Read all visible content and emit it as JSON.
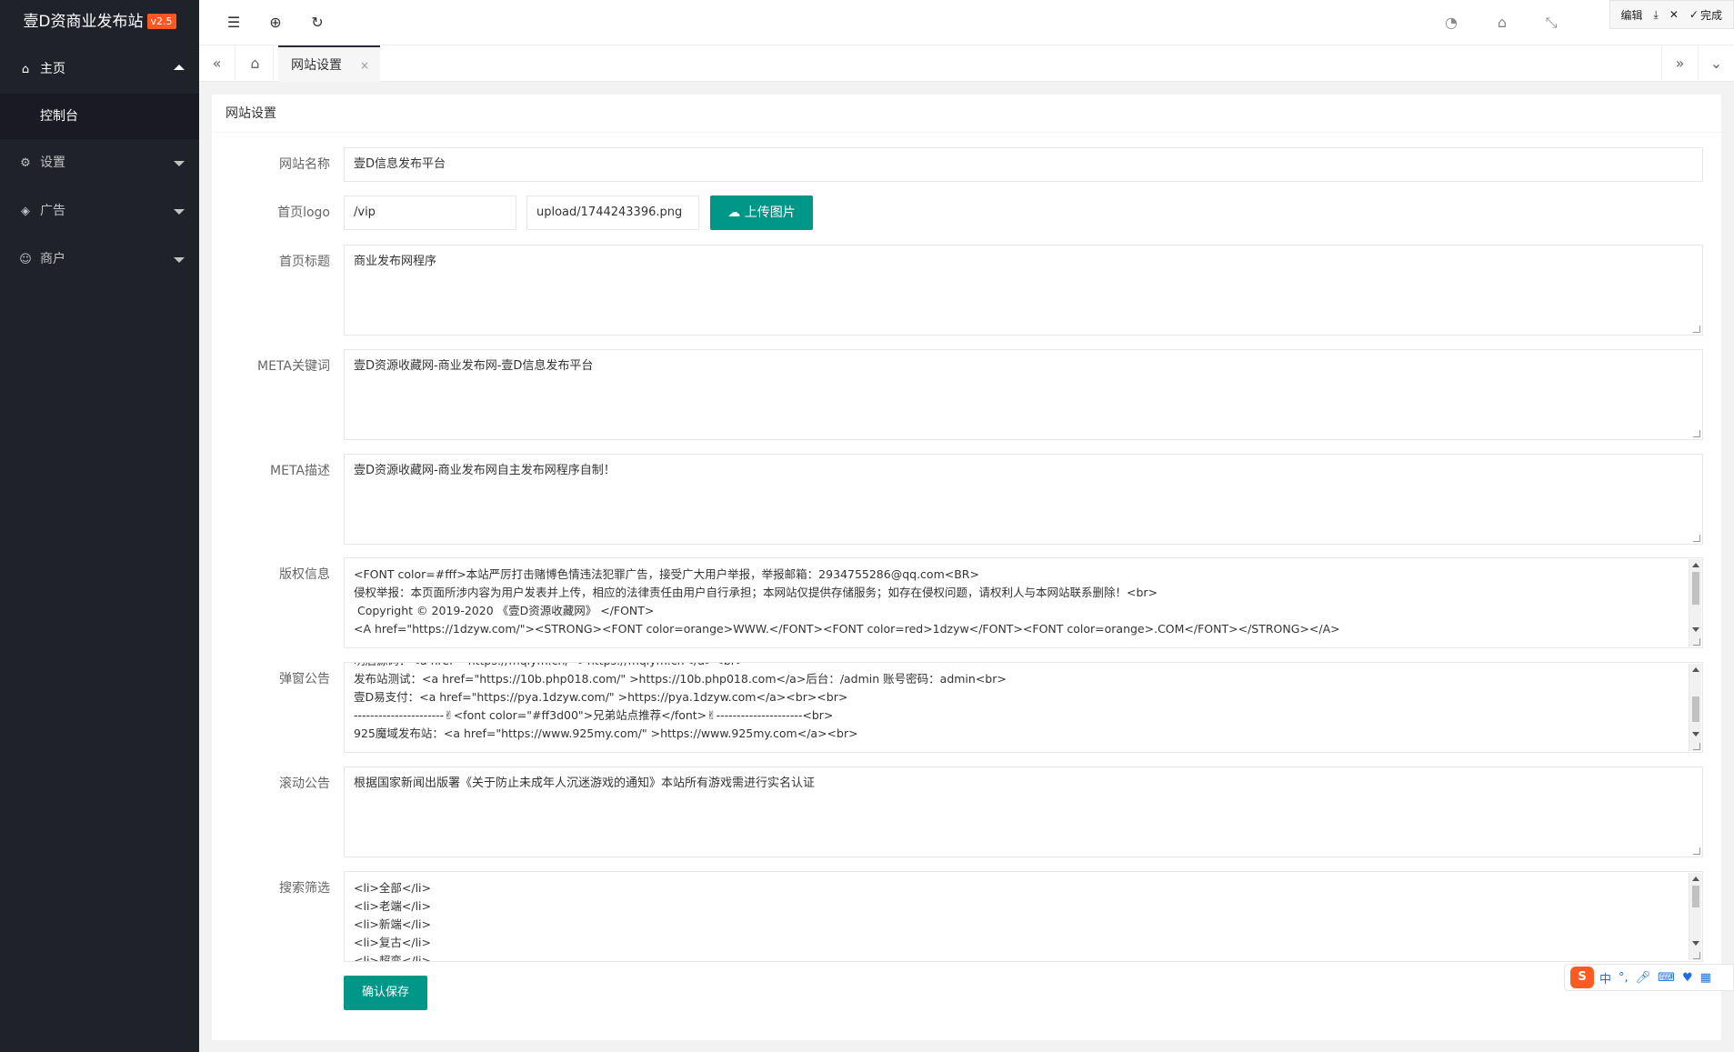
{
  "brand": {
    "title": "壹D资商业发布站",
    "version": "v2.5"
  },
  "sidebar": {
    "items": [
      {
        "label": "主页",
        "icon": "home-icon",
        "open": true,
        "sub": [
          "控制台"
        ]
      },
      {
        "label": "设置",
        "icon": "gear-icon"
      },
      {
        "label": "广告",
        "icon": "diamond-icon"
      },
      {
        "label": "商户",
        "icon": "user-icon"
      }
    ]
  },
  "float_bar": {
    "edit": "编辑",
    "done": "完成"
  },
  "tabs": {
    "active": "网站设置"
  },
  "card": {
    "title": "网站设置"
  },
  "form": {
    "site_name": {
      "label": "网站名称",
      "value": "壹D信息发布平台"
    },
    "logo": {
      "label": "首页logo",
      "prefix": "/vip",
      "path": "upload/1744243396.png",
      "upload_label": "上传图片"
    },
    "home_title": {
      "label": "首页标题",
      "value": "商业发布网程序"
    },
    "meta_keywords": {
      "label": "META关键词",
      "value": "壹D资源收藏网-商业发布网-壹D信息发布平台"
    },
    "meta_desc": {
      "label": "META描述",
      "value": "壹D资源收藏网-商业发布网自主发布网程序自制！"
    },
    "copyright": {
      "label": "版权信息",
      "value": "<FONT color=#fff>本站严厉打击赌博色情违法犯罪广告，接受广大用户举报，举报邮箱：2934755286@qq.com<BR>\n侵权举报：本页面所涉内容为用户发表并上传，相应的法律责任由用户自行承担；本网站仅提供存储服务；如存在侵权问题，请权利人与本网站联系删除！<br>\n Copyright © 2019-2020 《壹D资源收藏网》 </FONT>\n<A href=\"https://1dzyw.com/\"><STRONG><FONT color=orange>WWW.</FONT><FONT color=red>1dzyw</FONT><FONT color=orange>.COM</FONT></STRONG></A>"
    },
    "popup_notice": {
      "label": "弹窗公告",
      "value": "明后源码：<a href=\"https://mqlym.cn/\" >https://mqlym.cn</a><br>\n发布站测试：<a href=\"https://10b.php018.com/\" >https://10b.php018.com</a>后台：/admin 账号密码：admin<br>\n壹D易支付：<a href=\"https://pya.1dzyw.com/\" >https://pya.1dzyw.com</a><br><br>\n----------------------✌<font color=\"#ff3d00\">兄弟站点推荐</font>✌---------------------<br>\n925魔域发布站：<a href=\"https://www.925my.com/\" >https://www.925my.com</a><br>"
    },
    "scroll_notice": {
      "label": "滚动公告",
      "value": "根据国家新闻出版署《关于防止未成年人沉迷游戏的通知》本站所有游戏需进行实名认证"
    },
    "search_filter": {
      "label": "搜索筛选",
      "value": "<li>全部</li>\n<li>老端</li>\n<li>新端</li>\n<li>复古</li>\n<li>超变</li>"
    },
    "save_label": "确认保存"
  },
  "ime": {
    "lang": "中"
  }
}
